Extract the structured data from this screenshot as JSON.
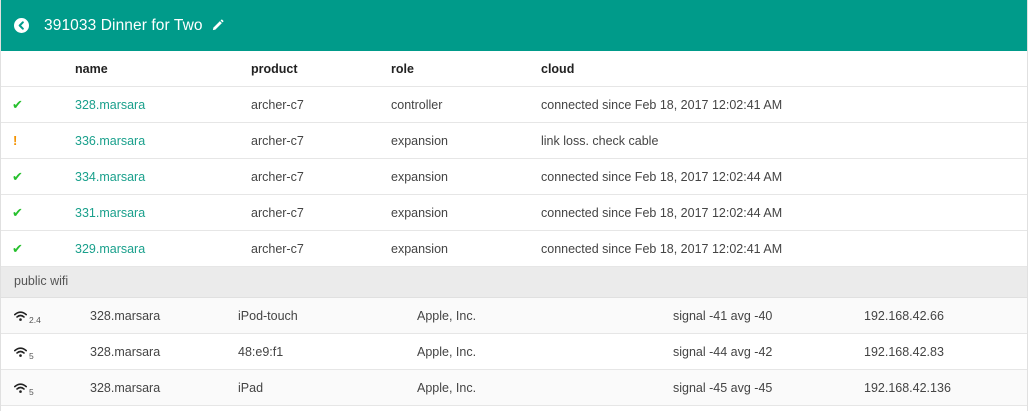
{
  "header": {
    "title": "391033 Dinner for Two",
    "back_icon": "circle-chevron-left-icon",
    "edit_icon": "pencil-icon",
    "color": "#009b8a"
  },
  "nodes_table": {
    "columns": {
      "name": "name",
      "product": "product",
      "role": "role",
      "cloud": "cloud"
    },
    "rows": [
      {
        "status": "✔",
        "status_icon": "check-icon",
        "name": "328.marsara",
        "product": "archer-c7",
        "role": "controller",
        "cloud": "connected since Feb 18, 2017 12:02:41 AM"
      },
      {
        "status": "!",
        "status_icon": "warning-icon",
        "name": "336.marsara",
        "product": "archer-c7",
        "role": "expansion",
        "cloud": "link loss. check cable"
      },
      {
        "status": "✔",
        "status_icon": "check-icon",
        "name": "334.marsara",
        "product": "archer-c7",
        "role": "expansion",
        "cloud": "connected since Feb 18, 2017 12:02:44 AM"
      },
      {
        "status": "✔",
        "status_icon": "check-icon",
        "name": "331.marsara",
        "product": "archer-c7",
        "role": "expansion",
        "cloud": "connected since Feb 18, 2017 12:02:44 AM"
      },
      {
        "status": "✔",
        "status_icon": "check-icon",
        "name": "329.marsara",
        "product": "archer-c7",
        "role": "expansion",
        "cloud": "connected since Feb 18, 2017 12:02:41 AM"
      }
    ]
  },
  "wifi_section": {
    "title": "public wifi",
    "clients": [
      {
        "band": "2.4",
        "node": "328.marsara",
        "device": "iPod-touch",
        "vendor": "Apple, Inc.",
        "signal": "signal -41 avg -40",
        "ip": "192.168.42.66"
      },
      {
        "band": "5",
        "node": "328.marsara",
        "device": "48:e9:f1",
        "vendor": "Apple, Inc.",
        "signal": "signal -44 avg -42",
        "ip": "192.168.42.83"
      },
      {
        "band": "5",
        "node": "328.marsara",
        "device": "iPad",
        "vendor": "Apple, Inc.",
        "signal": "signal -45 avg -45",
        "ip": "192.168.42.136"
      }
    ]
  },
  "colors": {
    "ok": "#26c02d",
    "warn": "#f39200",
    "link": "#1aa08c"
  }
}
